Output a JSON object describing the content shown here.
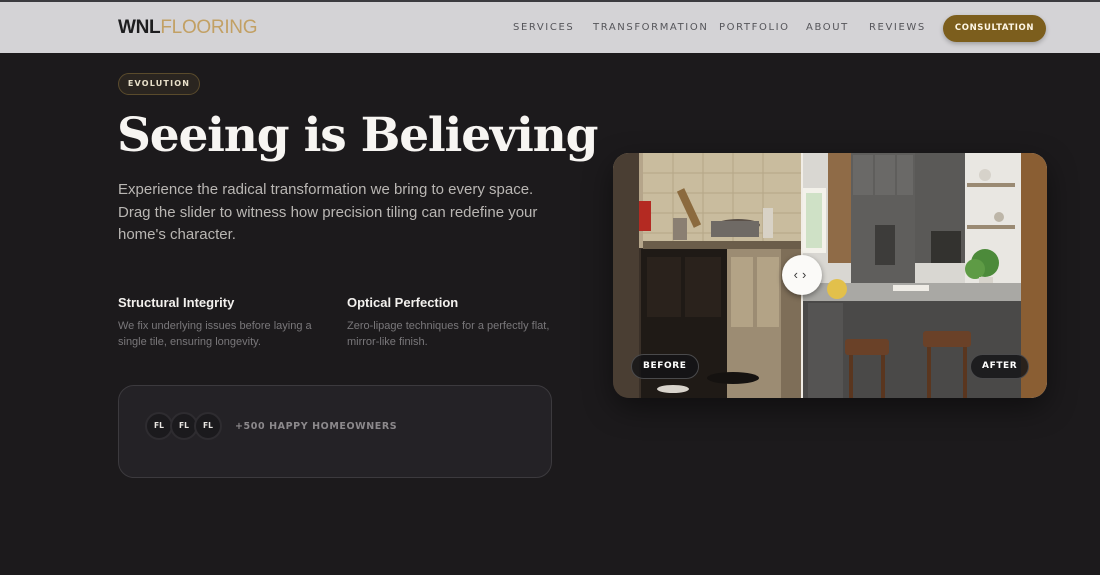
{
  "brand": {
    "part1": "WNL",
    "part2": "FLOORING",
    "accent": "#c2a064"
  },
  "nav": [
    {
      "label": "SERVICES"
    },
    {
      "label": "TRANSFORMATION"
    },
    {
      "label": "PORTFOLIO"
    },
    {
      "label": "ABOUT"
    },
    {
      "label": "REVIEWS"
    }
  ],
  "cta": {
    "label": "CONSULTATION",
    "color": "#7c5e1d"
  },
  "hero": {
    "badge": "EVOLUTION",
    "title": "Seeing is Believing",
    "description": "Experience the radical transformation we bring to every space. Drag the slider to witness how precision tiling can redefine your home's character."
  },
  "features": [
    {
      "title": "Structural Integrity",
      "desc": "We fix underlying issues before laying a single tile, ensuring longevity."
    },
    {
      "title": "Optical Perfection",
      "desc": "Zero-lipage techniques for a perfectly flat, mirror-like finish."
    }
  ],
  "social_proof": {
    "avatars": [
      "FL",
      "FL",
      "FL"
    ],
    "text": "+500 HAPPY HOMEOWNERS"
  },
  "comparison": {
    "before_label": "BEFORE",
    "after_label": "AFTER",
    "handle_icons": [
      "chevron-left-icon",
      "chevron-right-icon"
    ]
  }
}
